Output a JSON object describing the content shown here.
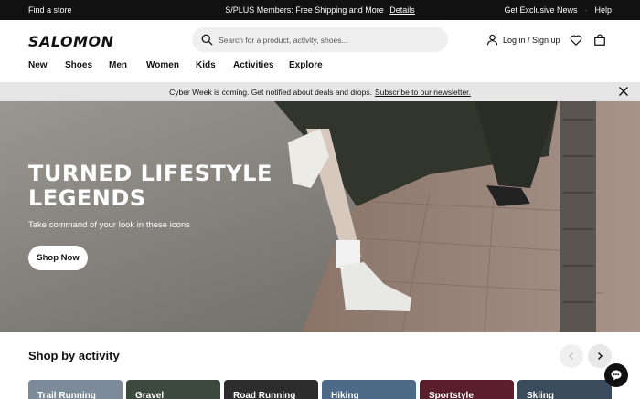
{
  "topbar": {
    "find_store": "Find a store",
    "promo_text": "S/PLUS Members: Free Shipping and More",
    "promo_link": "Details",
    "exclusive": "Get Exclusive News",
    "separator": "·",
    "help": "Help"
  },
  "header": {
    "logo": "SALOMON",
    "search_placeholder": "Search for a product, activity, shoes...",
    "login": "Log in / Sign up"
  },
  "nav": {
    "items": [
      "New",
      "Shoes",
      "Men",
      "Women",
      "Kids",
      "Activities",
      "Explore"
    ]
  },
  "promo_banner": {
    "text": "Cyber Week is coming. Get notified about deals and drops.",
    "link": "Subscribe to our newsletter."
  },
  "hero": {
    "title": "TURNED LIFESTYLE LEGENDS",
    "subtitle": "Take command of your look in these icons",
    "cta": "Shop Now"
  },
  "shop_by_activity": {
    "title": "Shop by activity",
    "cards": [
      {
        "label": "Trail Running",
        "color": "#7c8a99"
      },
      {
        "label": "Gravel",
        "color": "#3c4a3e"
      },
      {
        "label": "Road Running",
        "color": "#2d2d2d"
      },
      {
        "label": "Hiking",
        "color": "#4d6a88"
      },
      {
        "label": "Sportstyle",
        "color": "#5a1f2a"
      },
      {
        "label": "Skiing",
        "color": "#3a4c5c"
      }
    ]
  },
  "icons": {
    "search": "search-icon",
    "user": "user-icon",
    "wishlist": "heart-icon",
    "cart": "bag-icon",
    "close": "close-icon",
    "prev": "chevron-left-icon",
    "next": "chevron-right-icon",
    "chat": "chat-icon"
  }
}
